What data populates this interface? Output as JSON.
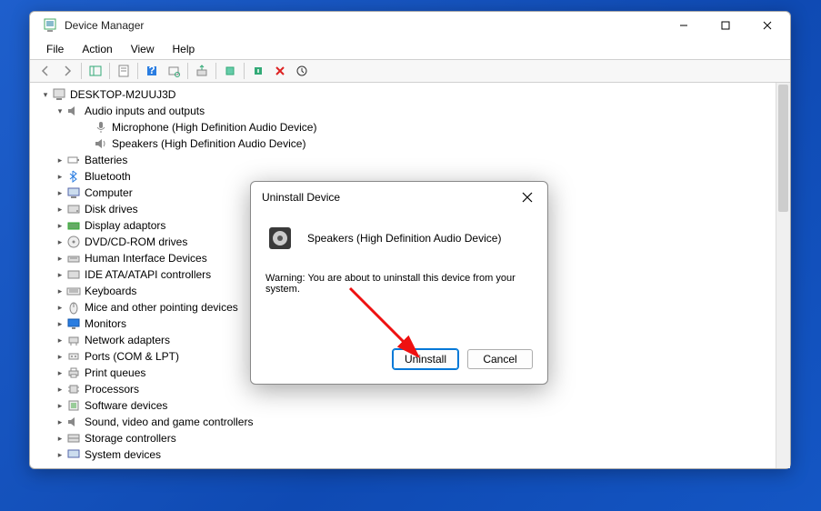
{
  "window": {
    "title": "Device Manager"
  },
  "menus": {
    "file": "File",
    "action": "Action",
    "view": "View",
    "help": "Help"
  },
  "tree": {
    "root": "DESKTOP-M2UUJ3D",
    "audio": {
      "label": "Audio inputs and outputs",
      "mic": "Microphone (High Definition Audio Device)",
      "speakers": "Speakers (High Definition Audio Device)"
    },
    "batteries": "Batteries",
    "bluetooth": "Bluetooth",
    "computer": "Computer",
    "diskdrives": "Disk drives",
    "display": "Display adaptors",
    "dvd": "DVD/CD-ROM drives",
    "hid": "Human Interface Devices",
    "ide": "IDE ATA/ATAPI controllers",
    "keyboards": "Keyboards",
    "mice": "Mice and other pointing devices",
    "monitors": "Monitors",
    "network": "Network adapters",
    "ports": "Ports (COM & LPT)",
    "printqueues": "Print queues",
    "processors": "Processors",
    "software": "Software devices",
    "sound": "Sound, video and game controllers",
    "storage": "Storage controllers",
    "system": "System devices"
  },
  "dialog": {
    "title": "Uninstall Device",
    "device": "Speakers (High Definition Audio Device)",
    "warning": "Warning: You are about to uninstall this device from your system.",
    "uninstall": "Uninstall",
    "cancel": "Cancel"
  }
}
